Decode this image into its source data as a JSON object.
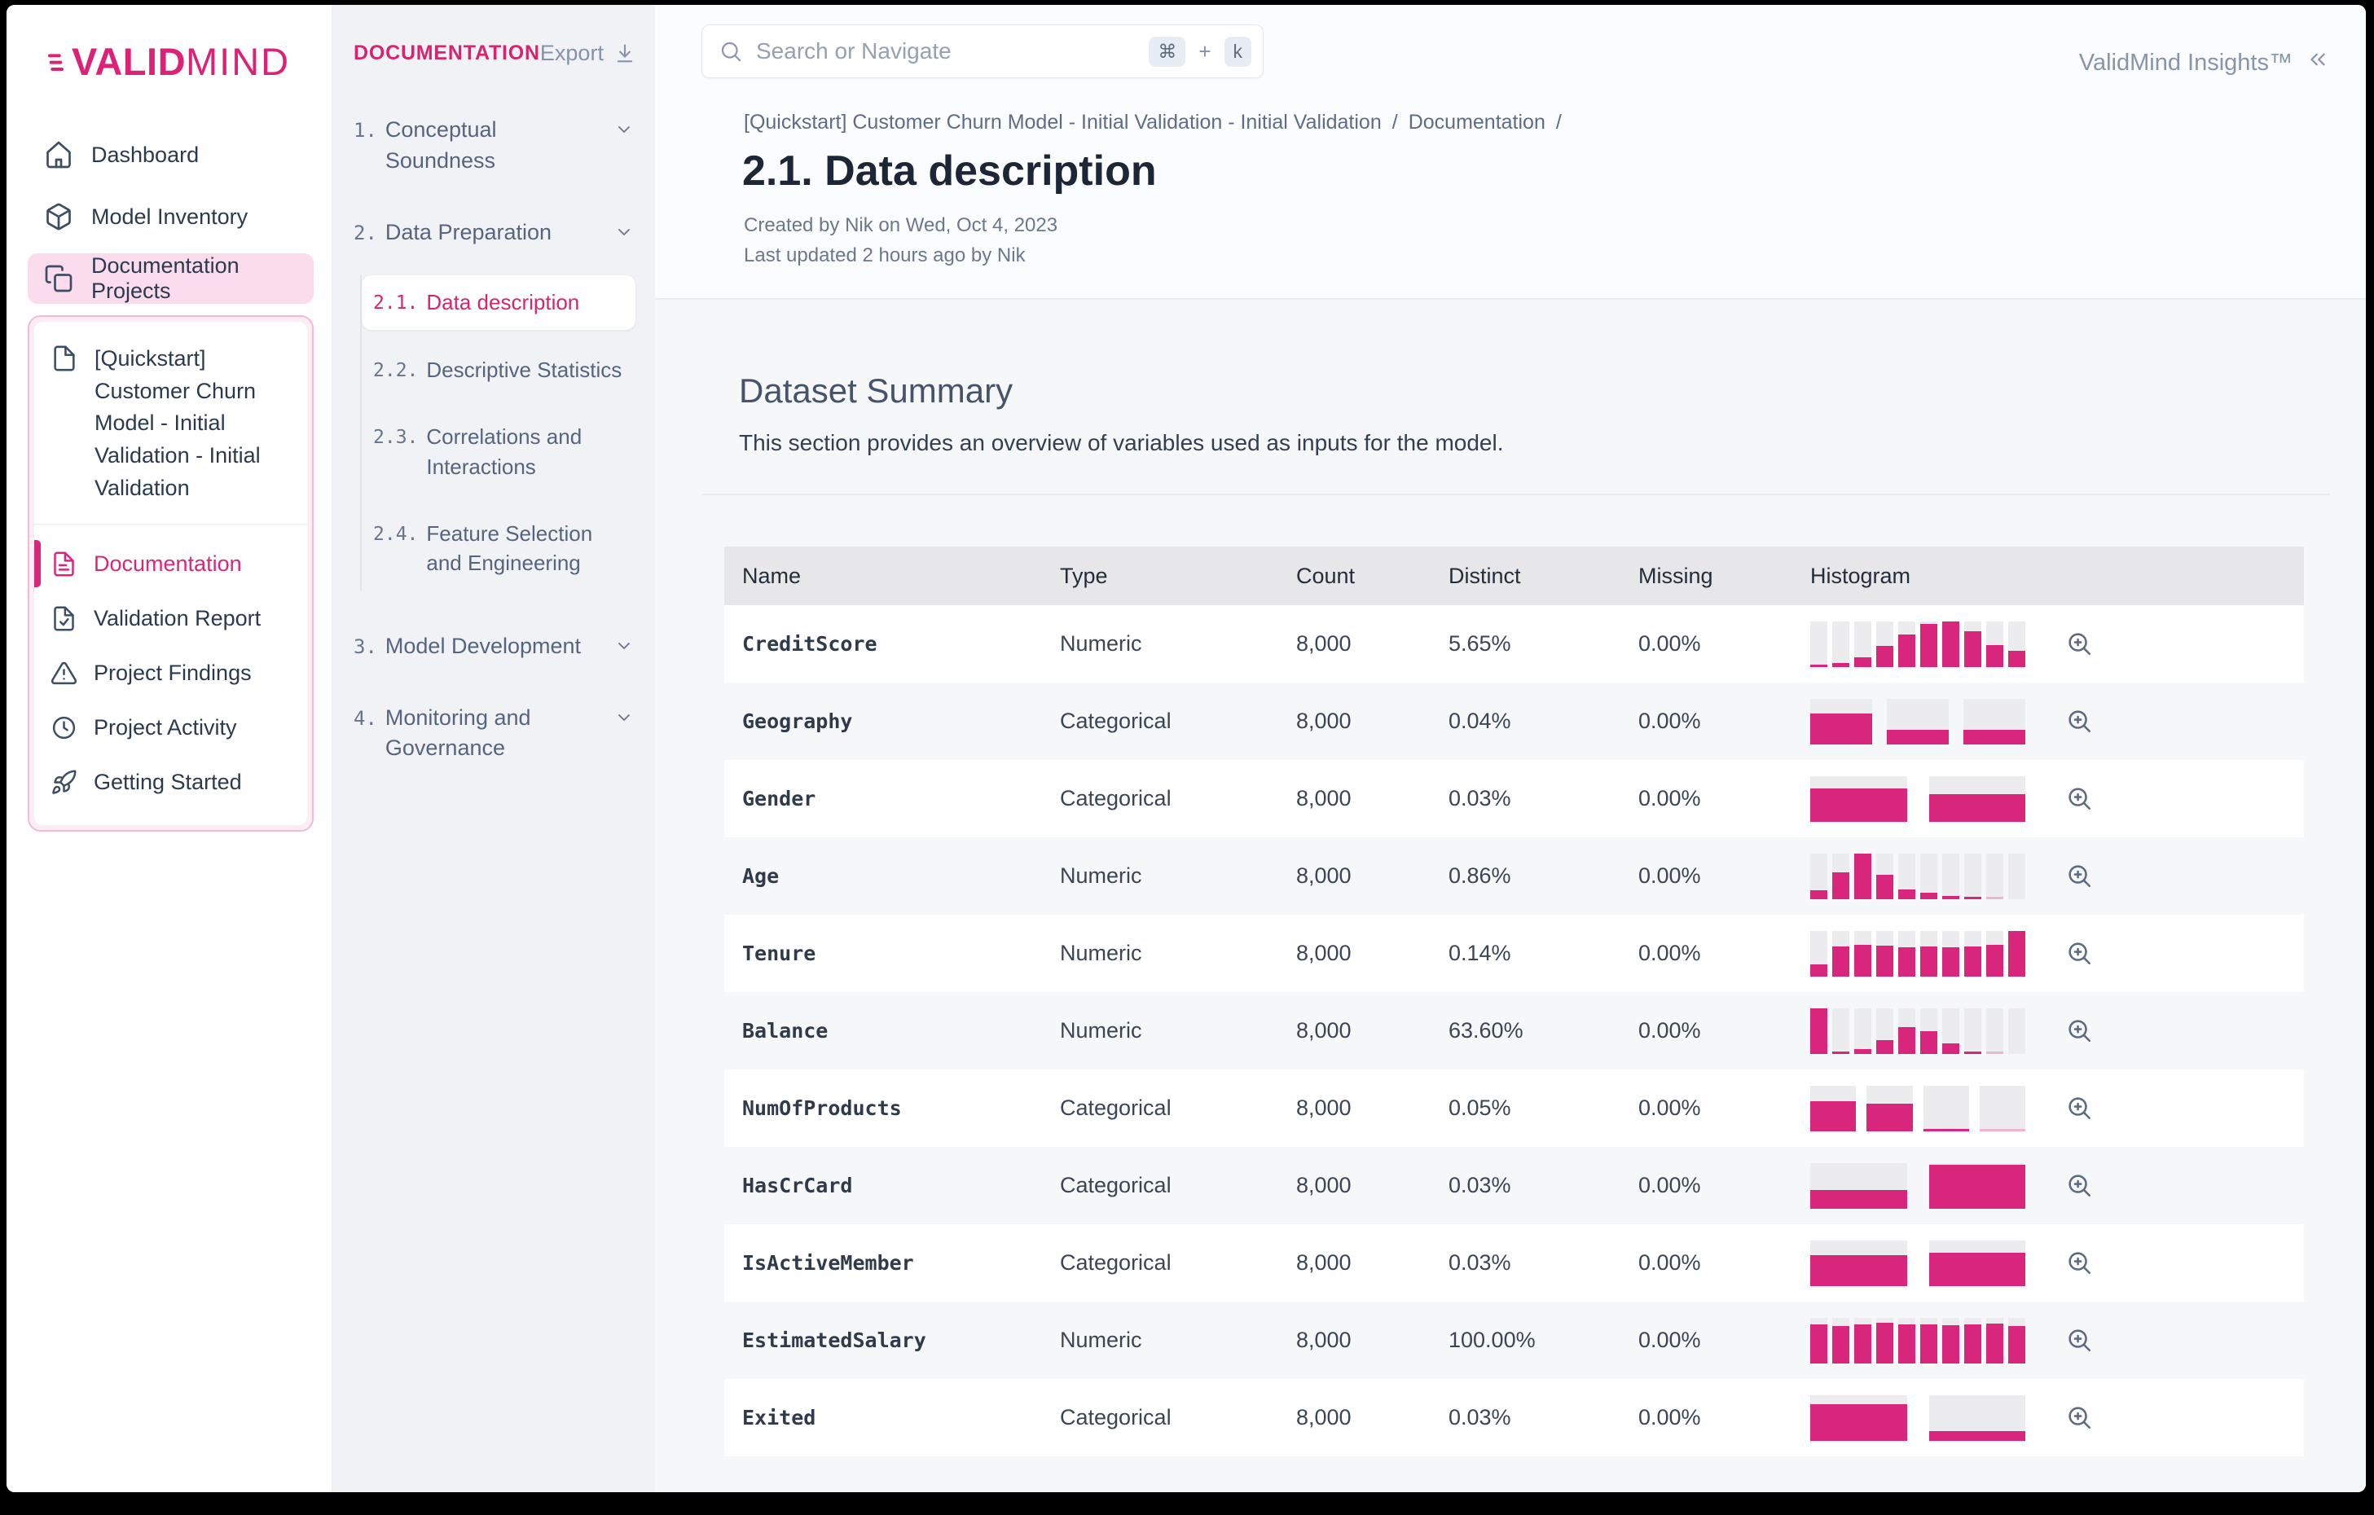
{
  "app": {
    "brand_bold": "VALID",
    "brand_light": "MIND",
    "insights_label": "ValidMind Insights™"
  },
  "search": {
    "placeholder": "Search or Navigate",
    "kbd_modifier": "⌘",
    "kbd_plus": "+",
    "kbd_key": "k"
  },
  "sidebar": {
    "items": [
      {
        "label": "Dashboard",
        "icon": "home",
        "active": false
      },
      {
        "label": "Model Inventory",
        "icon": "cubes",
        "active": false
      },
      {
        "label": "Documentation Projects",
        "icon": "copy",
        "active": true
      }
    ],
    "project_group": {
      "title": "[Quickstart] Customer Churn Model - Initial Validation - Initial Validation",
      "icon": "file",
      "items": [
        {
          "label": "Documentation",
          "icon": "file-text",
          "active": true
        },
        {
          "label": "Validation Report",
          "icon": "file-check",
          "active": false
        },
        {
          "label": "Project Findings",
          "icon": "alert-triangle",
          "active": false
        },
        {
          "label": "Project Activity",
          "icon": "clock",
          "active": false
        },
        {
          "label": "Getting Started",
          "icon": "rocket",
          "active": false
        }
      ]
    }
  },
  "doc_nav": {
    "header": "DOCUMENTATION",
    "export_label": "Export",
    "sections": [
      {
        "num": "1.",
        "label": "Conceptual Soundness",
        "chevron": true,
        "children": []
      },
      {
        "num": "2.",
        "label": "Data Preparation",
        "chevron": true,
        "children": [
          {
            "num": "2.1.",
            "label": "Data description",
            "active": true
          },
          {
            "num": "2.2.",
            "label": "Descriptive Statistics",
            "active": false
          },
          {
            "num": "2.3.",
            "label": "Correlations and Interactions",
            "active": false
          },
          {
            "num": "2.4.",
            "label": "Feature Selection and Engineering",
            "active": false
          }
        ]
      },
      {
        "num": "3.",
        "label": "Model Development",
        "chevron": true,
        "children": []
      },
      {
        "num": "4.",
        "label": "Monitoring and Governance",
        "chevron": true,
        "children": []
      }
    ]
  },
  "page": {
    "breadcrumb": [
      "[Quickstart] Customer Churn Model - Initial Validation - Initial Validation",
      "Documentation"
    ],
    "breadcrumb_separator": "/",
    "title": "2.1. Data description",
    "created": "Created by Nik on Wed, Oct 4, 2023",
    "updated": "Last updated 2 hours ago by Nik"
  },
  "section": {
    "heading": "Dataset Summary",
    "description": "This section provides an overview of variables used as inputs for the model."
  },
  "table": {
    "columns": [
      "Name",
      "Type",
      "Count",
      "Distinct",
      "Missing",
      "Histogram"
    ],
    "rows": [
      {
        "name": "CreditScore",
        "type": "Numeric",
        "count": "8,000",
        "distinct": "5.65%",
        "missing": "0.00%",
        "histogram": [
          3,
          8,
          20,
          45,
          70,
          93,
          100,
          77,
          47,
          35
        ]
      },
      {
        "name": "Geography",
        "type": "Categorical",
        "count": "8,000",
        "distinct": "0.04%",
        "missing": "0.00%",
        "histogram": [
          67,
          31,
          31
        ]
      },
      {
        "name": "Gender",
        "type": "Categorical",
        "count": "8,000",
        "distinct": "0.03%",
        "missing": "0.00%",
        "histogram": [
          72,
          60
        ]
      },
      {
        "name": "Age",
        "type": "Numeric",
        "count": "8,000",
        "distinct": "0.86%",
        "missing": "0.00%",
        "histogram": [
          19,
          58,
          100,
          52,
          21,
          13,
          6,
          3,
          1,
          0
        ]
      },
      {
        "name": "Tenure",
        "type": "Numeric",
        "count": "8,000",
        "distinct": "0.14%",
        "missing": "0.00%",
        "histogram": [
          26,
          65,
          69,
          67,
          64,
          65,
          64,
          66,
          68,
          100
        ]
      },
      {
        "name": "Balance",
        "type": "Numeric",
        "count": "8,000",
        "distinct": "63.60%",
        "missing": "0.00%",
        "histogram": [
          100,
          3,
          9,
          29,
          58,
          49,
          22,
          5,
          1,
          0
        ]
      },
      {
        "name": "NumOfProducts",
        "type": "Categorical",
        "count": "8,000",
        "distinct": "0.05%",
        "missing": "0.00%",
        "histogram": [
          66,
          60,
          4,
          1
        ]
      },
      {
        "name": "HasCrCard",
        "type": "Categorical",
        "count": "8,000",
        "distinct": "0.03%",
        "missing": "0.00%",
        "histogram": [
          40,
          95
        ]
      },
      {
        "name": "IsActiveMember",
        "type": "Categorical",
        "count": "8,000",
        "distinct": "0.03%",
        "missing": "0.00%",
        "histogram": [
          67,
          73
        ]
      },
      {
        "name": "EstimatedSalary",
        "type": "Numeric",
        "count": "8,000",
        "distinct": "100.00%",
        "missing": "0.00%",
        "histogram": [
          84,
          82,
          84,
          89,
          84,
          85,
          83,
          84,
          86,
          82
        ]
      },
      {
        "name": "Exited",
        "type": "Categorical",
        "count": "8,000",
        "distinct": "0.03%",
        "missing": "0.00%",
        "histogram": [
          79,
          20
        ]
      }
    ]
  },
  "colors": {
    "accent_pink": "#d9267d",
    "accent_pink_faint": "#f2b3d2",
    "active_nav_bg": "#fbdcec",
    "table_header_bg": "#e7e7ea",
    "histogram_track": "#ececee"
  }
}
